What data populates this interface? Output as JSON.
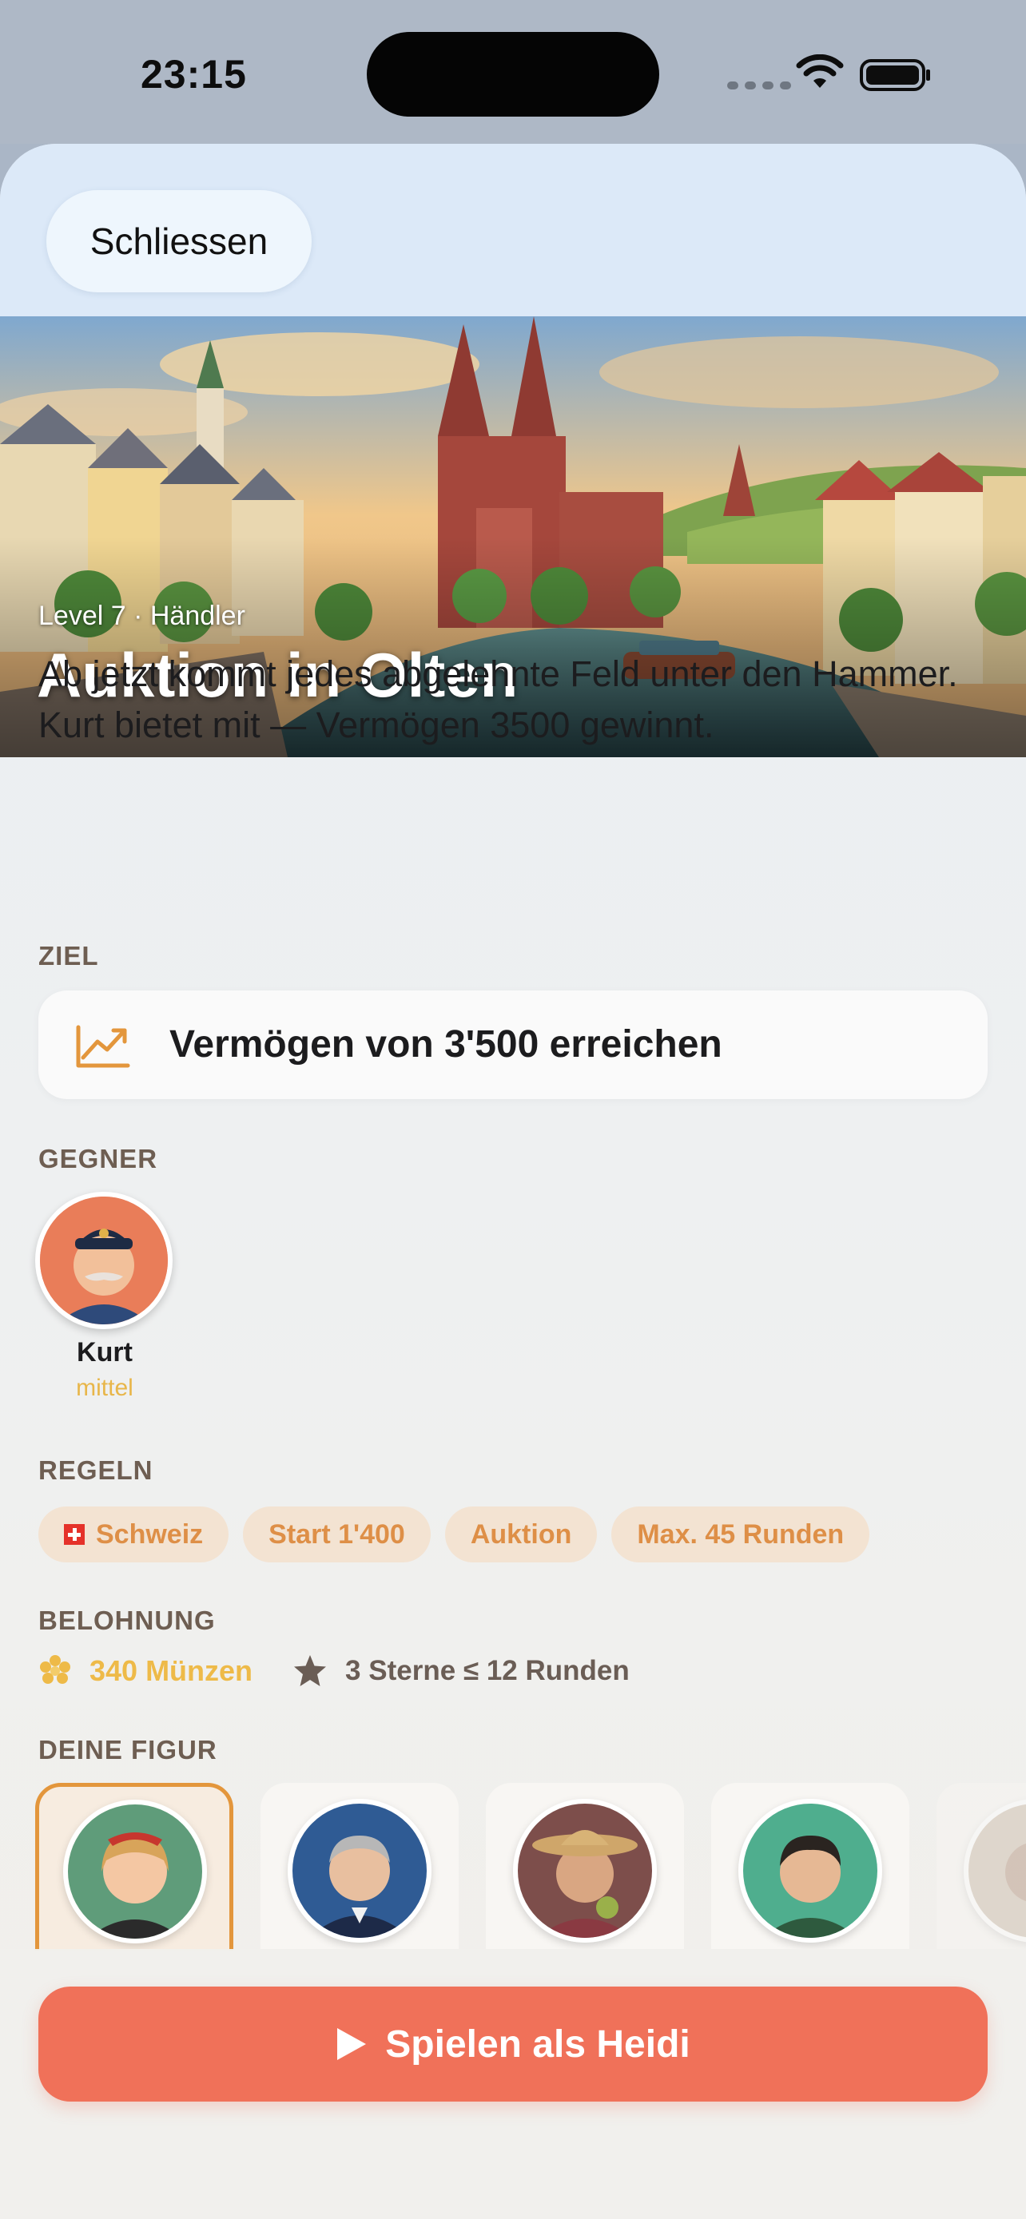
{
  "status_bar": {
    "time": "23:15"
  },
  "header": {
    "close_label": "Schliessen"
  },
  "hero": {
    "subtitle": "Level 7 · Händler",
    "title": "Auktion in Olten"
  },
  "description": "Ab jetzt kommt jedes abgelehnte Feld unter den Hammer. Kurt bietet mit — Vermögen 3500 gewinnt.",
  "goal": {
    "section_label": "ZIEL",
    "text": "Vermögen von 3'500 erreichen",
    "icon": "trending-up-icon"
  },
  "opponents": {
    "section_label": "GEGNER",
    "items": [
      {
        "name": "Kurt",
        "level": "mittel"
      }
    ]
  },
  "rules": {
    "section_label": "REGELN",
    "chips": [
      "Schweiz",
      "Start 1'400",
      "Auktion",
      "Max. 45 Runden"
    ]
  },
  "reward": {
    "section_label": "BELOHNUNG",
    "coins": "340 Münzen",
    "stars": "3 Sterne ≤ 12 Runden"
  },
  "figures": {
    "section_label": "DEINE FIGUR",
    "selected_index": 0
  },
  "play_button": {
    "label": "Spielen als Heidi"
  },
  "colors": {
    "accent": "#f07159",
    "chip_text": "#de8f47",
    "chip_bg": "#f3e3d2",
    "coin": "#eeba48",
    "selected_border": "#e3963c"
  }
}
